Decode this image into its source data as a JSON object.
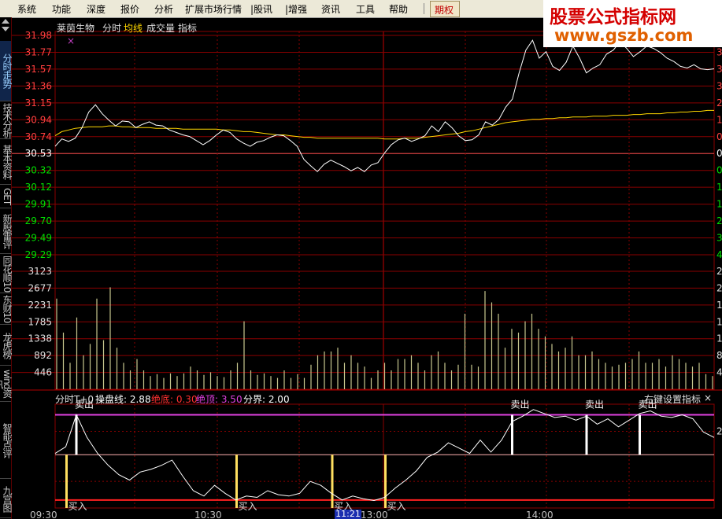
{
  "menu": {
    "items": [
      "系统",
      "功能",
      "深度",
      "报价",
      "分析",
      "扩展市场行情",
      "|股讯",
      "|增强",
      "资讯",
      "工具",
      "帮助"
    ],
    "special": "期权"
  },
  "logo": {
    "title": "股票公式指标网",
    "url": "www.gszb.com"
  },
  "sidebar": {
    "tabs": [
      {
        "label": "分时走势",
        "active": true
      },
      {
        "label": "技术分析",
        "active": false
      },
      {
        "label": "基本资料",
        "active": false
      },
      {
        "label": "GET",
        "active": false
      },
      {
        "label": "新股雷评",
        "active": false
      },
      {
        "label": "同花顺10",
        "active": false
      },
      {
        "label": "东财10",
        "active": false
      },
      {
        "label": "龙虎榜",
        "active": false
      },
      {
        "label": "wind资讯",
        "active": false
      },
      {
        "label": "智能点评",
        "active": false
      },
      {
        "label": "九宫图",
        "active": false
      }
    ]
  },
  "header": {
    "stock_name": "莱茵生物",
    "tabs": [
      {
        "label": "分时",
        "color": "#e0e0e0"
      },
      {
        "label": "均线",
        "color": "#ffd700"
      },
      {
        "label": "成交量",
        "color": "#e0e0e0"
      },
      {
        "label": "指标",
        "color": "#e0e0e0"
      }
    ]
  },
  "indicator_header": {
    "name": "分时T+0",
    "params": [
      {
        "label": "操盘线: 2.88",
        "color": "#ffffff"
      },
      {
        "label": "绝底: 0.30",
        "color": "#ff3030"
      },
      {
        "label": "绝顶: 3.50",
        "color": "#e040e0"
      },
      {
        "label": "分界: 2.00",
        "color": "#ffffff"
      }
    ],
    "right_button": "右键设置指标",
    "close": "×"
  },
  "price_axis": [
    "31.98",
    "31.77",
    "31.57",
    "31.36",
    "31.15",
    "30.94",
    "30.74",
    "30.53",
    "30.32",
    "30.12",
    "29.91",
    "29.70",
    "29.49",
    "29.29"
  ],
  "price_axis_colors": [
    "#ff4040",
    "#ff4040",
    "#ff4040",
    "#ff4040",
    "#ff4040",
    "#ff4040",
    "#ff4040",
    "#ffffff",
    "#00e000",
    "#00e000",
    "#00e000",
    "#00e000",
    "#00e000",
    "#00e000"
  ],
  "volume_axis": [
    "3123",
    "2677",
    "2231",
    "1785",
    "1338",
    "892",
    "446"
  ],
  "right_axis_price": [
    "4",
    "3",
    "3",
    "3",
    "2",
    "1",
    "0",
    "0",
    "0",
    "1",
    "1",
    "2",
    "3",
    "4"
  ],
  "right_axis_price_colors": [
    "#ff4040",
    "#ff4040",
    "#ff4040",
    "#ff4040",
    "#ff4040",
    "#ff4040",
    "#ff4040",
    "#ffffff",
    "#00e000",
    "#00e000",
    "#00e000",
    "#00e000",
    "#00e000",
    "#00e000"
  ],
  "right_axis_volume": [
    "2",
    "2",
    "1",
    "1",
    "1",
    "8",
    "4"
  ],
  "right_axis_indicator": "2",
  "time_axis": [
    "09:30",
    "10:30",
    "13:00",
    "14:00"
  ],
  "time_cursor": "11:21",
  "sell_label": "卖出",
  "buy_label": "买入",
  "colors": {
    "up": "#ff3030",
    "down": "#00e000",
    "price_line": "#ffffff",
    "avg_line": "#ffd700",
    "grid": "#8a0000",
    "top_line": "#e040e0",
    "mid_line": "#ffb0b0",
    "bottom_line": "#ff2020",
    "volume": "#c8c890"
  },
  "chart_data": {
    "type": "line",
    "series": [
      {
        "values": [
          30.62,
          30.71,
          30.68,
          30.72,
          30.85,
          31.04,
          31.13,
          31.02,
          30.94,
          30.87,
          30.93,
          30.92,
          30.85,
          30.89,
          30.92,
          30.88,
          30.87,
          30.82,
          30.79,
          30.76,
          30.74,
          30.69,
          30.64,
          30.69,
          30.76,
          30.82,
          30.79,
          30.71,
          30.66,
          30.62,
          30.67,
          30.69,
          30.73,
          30.76,
          30.75,
          30.69,
          30.62,
          30.46,
          30.38,
          30.31,
          30.4,
          30.45,
          30.41,
          30.37,
          30.32,
          30.36,
          30.31,
          30.39,
          30.42,
          30.54,
          30.64,
          30.7,
          30.72,
          30.68,
          30.71,
          30.75,
          30.87,
          30.8,
          30.92,
          30.85,
          30.75,
          30.69,
          30.7,
          30.76,
          30.92,
          30.88,
          30.95,
          31.1,
          31.2,
          31.52,
          31.8,
          31.92,
          31.7,
          31.78,
          31.6,
          31.55,
          31.65,
          31.85,
          31.7,
          31.52,
          31.58,
          31.62,
          31.75,
          31.8,
          31.9,
          31.82,
          31.72,
          31.78,
          31.85,
          31.82,
          31.77,
          31.7,
          31.66,
          31.6,
          31.58,
          31.62,
          31.57,
          31.56,
          31.57
        ]
      },
      {
        "values": [
          30.75,
          30.8,
          30.82,
          30.84,
          30.85,
          30.86,
          30.86,
          30.86,
          30.87,
          30.87,
          30.86,
          30.86,
          30.85,
          30.85,
          30.85,
          30.84,
          30.84,
          30.84,
          30.84,
          30.83,
          30.83,
          30.83,
          30.83,
          30.83,
          30.83,
          30.82,
          30.82,
          30.81,
          30.8,
          30.8,
          30.79,
          30.78,
          30.77,
          30.76,
          30.76,
          30.75,
          30.74,
          30.73,
          30.73,
          30.72,
          30.72,
          30.72,
          30.72,
          30.72,
          30.72,
          30.72,
          30.72,
          30.72,
          30.72,
          30.71,
          30.71,
          30.71,
          30.72,
          30.72,
          30.72,
          30.73,
          30.74,
          30.75,
          30.76,
          30.77,
          30.78,
          30.8,
          30.81,
          30.83,
          30.85,
          30.87,
          30.89,
          30.91,
          30.92,
          30.93,
          30.94,
          30.95,
          30.95,
          30.96,
          30.96,
          30.97,
          30.97,
          30.98,
          30.98,
          30.98,
          30.99,
          30.99,
          30.99,
          31.0,
          31.0,
          31.0,
          31.01,
          31.01,
          31.02,
          31.02,
          31.02,
          31.03,
          31.03,
          31.04,
          31.04,
          31.05,
          31.05,
          31.06,
          31.06
        ]
      }
    ],
    "volume": [
      2400,
      1500,
      700,
      1900,
      900,
      1200,
      2400,
      1300,
      2700,
      1100,
      700,
      500,
      800,
      500,
      350,
      400,
      300,
      420,
      350,
      420,
      600,
      500,
      380,
      450,
      350,
      320,
      500,
      700,
      1800,
      500,
      380,
      420,
      350,
      300,
      500,
      300,
      400,
      300,
      650,
      900,
      1000,
      1000,
      1100,
      700,
      900,
      700,
      600,
      300,
      500,
      700,
      500,
      800,
      800,
      900,
      700,
      500,
      900,
      1000,
      700,
      500,
      650,
      2000,
      650,
      600,
      2600,
      2300,
      2000,
      1100,
      1600,
      1500,
      1800,
      2000,
      1600,
      1400,
      1200,
      1000,
      1100,
      1400,
      900,
      900,
      1000,
      800,
      700,
      600,
      650,
      700,
      800,
      1000,
      700,
      700,
      800,
      600,
      900,
      800,
      700,
      600,
      700,
      400,
      350
    ],
    "indicator": [
      2.05,
      2.3,
      3.5,
      2.65,
      2.05,
      1.6,
      1.25,
      1.05,
      1.35,
      1.45,
      1.6,
      1.8,
      1.2,
      0.65,
      0.45,
      0.85,
      0.55,
      0.3,
      0.45,
      0.4,
      0.65,
      0.5,
      0.45,
      0.55,
      1.0,
      0.85,
      0.55,
      0.3,
      0.45,
      0.35,
      0.28,
      0.4,
      0.75,
      1.05,
      1.4,
      1.9,
      2.1,
      2.45,
      2.25,
      2.05,
      2.55,
      2.1,
      2.55,
      3.25,
      3.45,
      3.7,
      3.55,
      3.4,
      3.45,
      3.3,
      3.45,
      3.15,
      3.35,
      3.05,
      3.3,
      3.55,
      3.65,
      3.45,
      3.4,
      3.5,
      3.35,
      2.85,
      2.65
    ],
    "ylim_price": [
      29.29,
      31.98
    ],
    "ylim_volume": [
      0,
      3123
    ],
    "ylim_indicator": [
      0,
      3.9
    ],
    "x_ticks": [
      "09:30",
      "10:30",
      "13:00",
      "14:00"
    ]
  }
}
